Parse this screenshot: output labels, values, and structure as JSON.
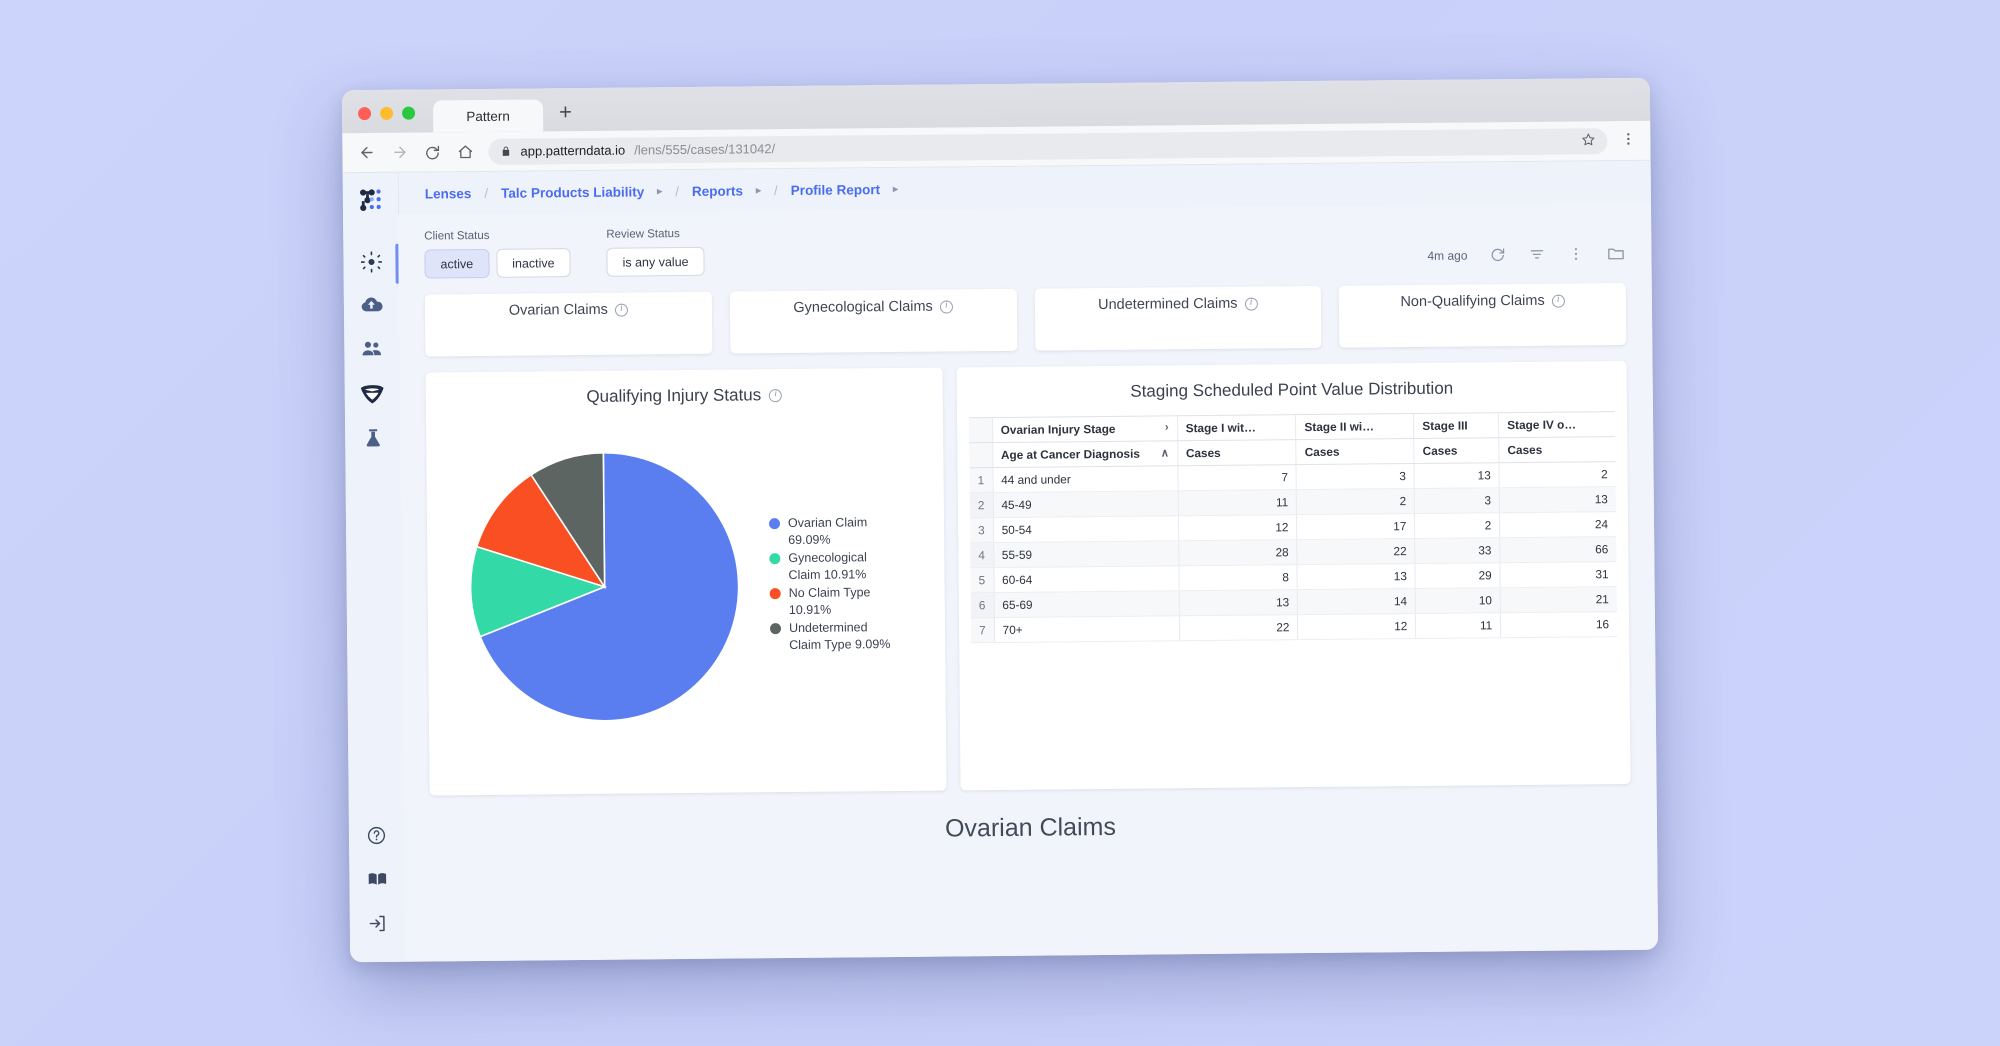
{
  "browser": {
    "tab_title": "Pattern",
    "new_tab_label": "+",
    "url_host": "app.patterndata.io",
    "url_path": "/lens/555/cases/131042/",
    "back_icon": "back-arrow-icon",
    "forward_icon": "forward-arrow-icon",
    "reload_icon": "reload-icon",
    "home_icon": "home-icon",
    "lock_icon": "lock-icon",
    "star_icon": "star-icon",
    "menu_icon": "kebab-menu-icon"
  },
  "sidebar": {
    "logo_name": "pattern-logo",
    "items": [
      {
        "name": "sidebar-item-insights",
        "icon": "sparkle-icon",
        "active": true
      },
      {
        "name": "sidebar-item-upload",
        "icon": "cloud-upload-icon",
        "active": false
      },
      {
        "name": "sidebar-item-clients",
        "icon": "people-icon",
        "active": false
      },
      {
        "name": "sidebar-item-lenses",
        "icon": "diamond-shield-icon",
        "active": false
      },
      {
        "name": "sidebar-item-lab",
        "icon": "flask-icon",
        "active": false
      }
    ],
    "bottom_items": [
      {
        "name": "sidebar-item-help",
        "icon": "question-circle-icon"
      },
      {
        "name": "sidebar-item-docs",
        "icon": "book-icon"
      },
      {
        "name": "sidebar-item-signout",
        "icon": "exit-arrow-icon"
      }
    ]
  },
  "breadcrumb": {
    "items": [
      {
        "label": "Lenses",
        "has_caret": false
      },
      {
        "label": "Talc Products Liability",
        "has_caret": true
      },
      {
        "label": "Reports",
        "has_caret": true
      },
      {
        "label": "Profile Report",
        "has_caret": true
      }
    ],
    "separator": "/",
    "caret": "▸"
  },
  "filters": {
    "client_status": {
      "label": "Client Status",
      "options": [
        {
          "label": "active",
          "selected": true
        },
        {
          "label": "inactive",
          "selected": false
        }
      ]
    },
    "review_status": {
      "label": "Review Status",
      "options": [
        {
          "label": "is any value",
          "selected": false
        }
      ]
    }
  },
  "toolbar": {
    "timestamp": "4m ago",
    "refresh_icon": "refresh-icon",
    "filter_icon": "filter-icon",
    "more_icon": "more-vertical-icon",
    "folder_icon": "folder-icon"
  },
  "kpi_cards": [
    {
      "title": "Ovarian Claims",
      "info": "i"
    },
    {
      "title": "Gynecological Claims",
      "info": "i"
    },
    {
      "title": "Undetermined Claims",
      "info": "i"
    },
    {
      "title": "Non-Qualifying Claims",
      "info": "i"
    }
  ],
  "pie_panel": {
    "title": "Qualifying Injury Status",
    "info": "i"
  },
  "table_panel": {
    "title": "Staging Scheduled Point Value Distribution",
    "group_header": {
      "label": "Ovarian Injury Stage",
      "expand_caret": "›",
      "stages": [
        "Stage I wit…",
        "Stage II wi…",
        "Stage III",
        "Stage IV o…"
      ]
    },
    "sub_header": {
      "label": "Age at Cancer Diagnosis",
      "sort_caret": "∧",
      "measures": [
        "Cases",
        "Cases",
        "Cases",
        "Cases"
      ]
    },
    "rows": [
      {
        "index": "1",
        "age": "44 and under",
        "values": [
          "7",
          "3",
          "13",
          "2"
        ]
      },
      {
        "index": "2",
        "age": "45-49",
        "values": [
          "11",
          "2",
          "3",
          "13"
        ]
      },
      {
        "index": "3",
        "age": "50-54",
        "values": [
          "12",
          "17",
          "2",
          "24"
        ]
      },
      {
        "index": "4",
        "age": "55-59",
        "values": [
          "28",
          "22",
          "33",
          "66"
        ]
      },
      {
        "index": "5",
        "age": "60-64",
        "values": [
          "8",
          "13",
          "29",
          "31"
        ]
      },
      {
        "index": "6",
        "age": "65-69",
        "values": [
          "13",
          "14",
          "10",
          "21"
        ]
      },
      {
        "index": "7",
        "age": "70+",
        "values": [
          "22",
          "12",
          "11",
          "16"
        ]
      }
    ]
  },
  "bottom_title": "Ovarian Claims",
  "chart_data": {
    "type": "pie",
    "title": "Qualifying Injury Status",
    "labels": [
      "Ovarian Claim",
      "Gynecological Claim",
      "No Claim Type",
      "Undetermined Claim Type"
    ],
    "values": [
      69.09,
      10.91,
      10.91,
      9.09
    ],
    "value_suffix": "%",
    "colors": [
      "#5a7ef0",
      "#33d9a6",
      "#fa4e23",
      "#5d6562"
    ],
    "legend_position": "right",
    "legend_entries": [
      "Ovarian Claim 69.09%",
      "Gynecological Claim 10.91%",
      "No Claim Type 10.91%",
      "Undetermined Claim Type 9.09%"
    ],
    "start_angle_deg": 0,
    "direction": "clockwise"
  },
  "chart_data_table": {
    "type": "table",
    "title": "Staging Scheduled Point Value Distribution",
    "row_label": "Age at Cancer Diagnosis",
    "categories": [
      "44 and under",
      "45-49",
      "50-54",
      "55-59",
      "60-64",
      "65-69",
      "70+"
    ],
    "series": [
      {
        "name": "Stage I wit…",
        "measure": "Cases",
        "values": [
          7,
          11,
          12,
          28,
          8,
          13,
          22
        ]
      },
      {
        "name": "Stage II wi…",
        "measure": "Cases",
        "values": [
          3,
          2,
          17,
          22,
          13,
          14,
          12
        ]
      },
      {
        "name": "Stage III",
        "measure": "Cases",
        "values": [
          13,
          3,
          2,
          33,
          29,
          10,
          11
        ]
      },
      {
        "name": "Stage IV o…",
        "measure": "Cases",
        "values": [
          2,
          13,
          24,
          66,
          31,
          21,
          16
        ]
      }
    ]
  },
  "theme": {
    "accent": "#4a6cf0",
    "rail_bg": "#eef2fa",
    "page_bg": "#f1f4fa",
    "pie_blue": "#5a7ef0",
    "pie_teal": "#33d9a6",
    "pie_orange": "#fa4e23",
    "pie_gray": "#5d6562"
  }
}
